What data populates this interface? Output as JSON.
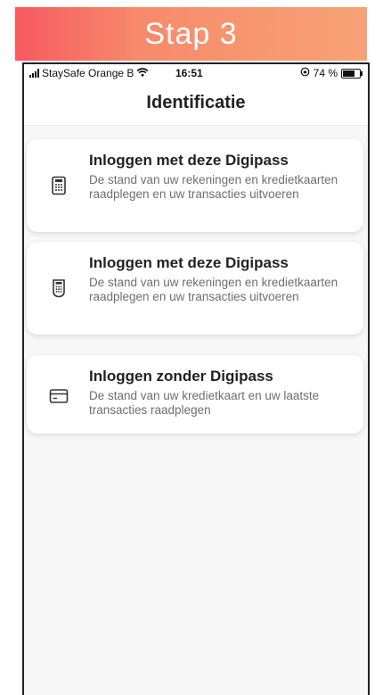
{
  "banner": {
    "title": "Stap 3"
  },
  "status_bar": {
    "carrier": "StaySafe Orange B",
    "time": "16:51",
    "battery": "74 %",
    "battery_level": 0.74
  },
  "nav": {
    "title": "Identificatie"
  },
  "options": [
    {
      "title": "Inloggen met deze Digipass",
      "description": "De stand van uw rekeningen en kredietkaarten raadplegen en uw transacties uitvoeren",
      "icon": "keypad-calculator-icon"
    },
    {
      "title": "Inloggen met deze Digipass",
      "description": "De stand van uw rekeningen en kredietkaarten raadplegen en uw transacties uitvoeren",
      "icon": "digipass-device-icon"
    },
    {
      "title": "Inloggen zonder Digipass",
      "description": "De stand van uw kredietkaart en uw laatste transacties raadplegen",
      "icon": "credit-card-icon"
    }
  ]
}
